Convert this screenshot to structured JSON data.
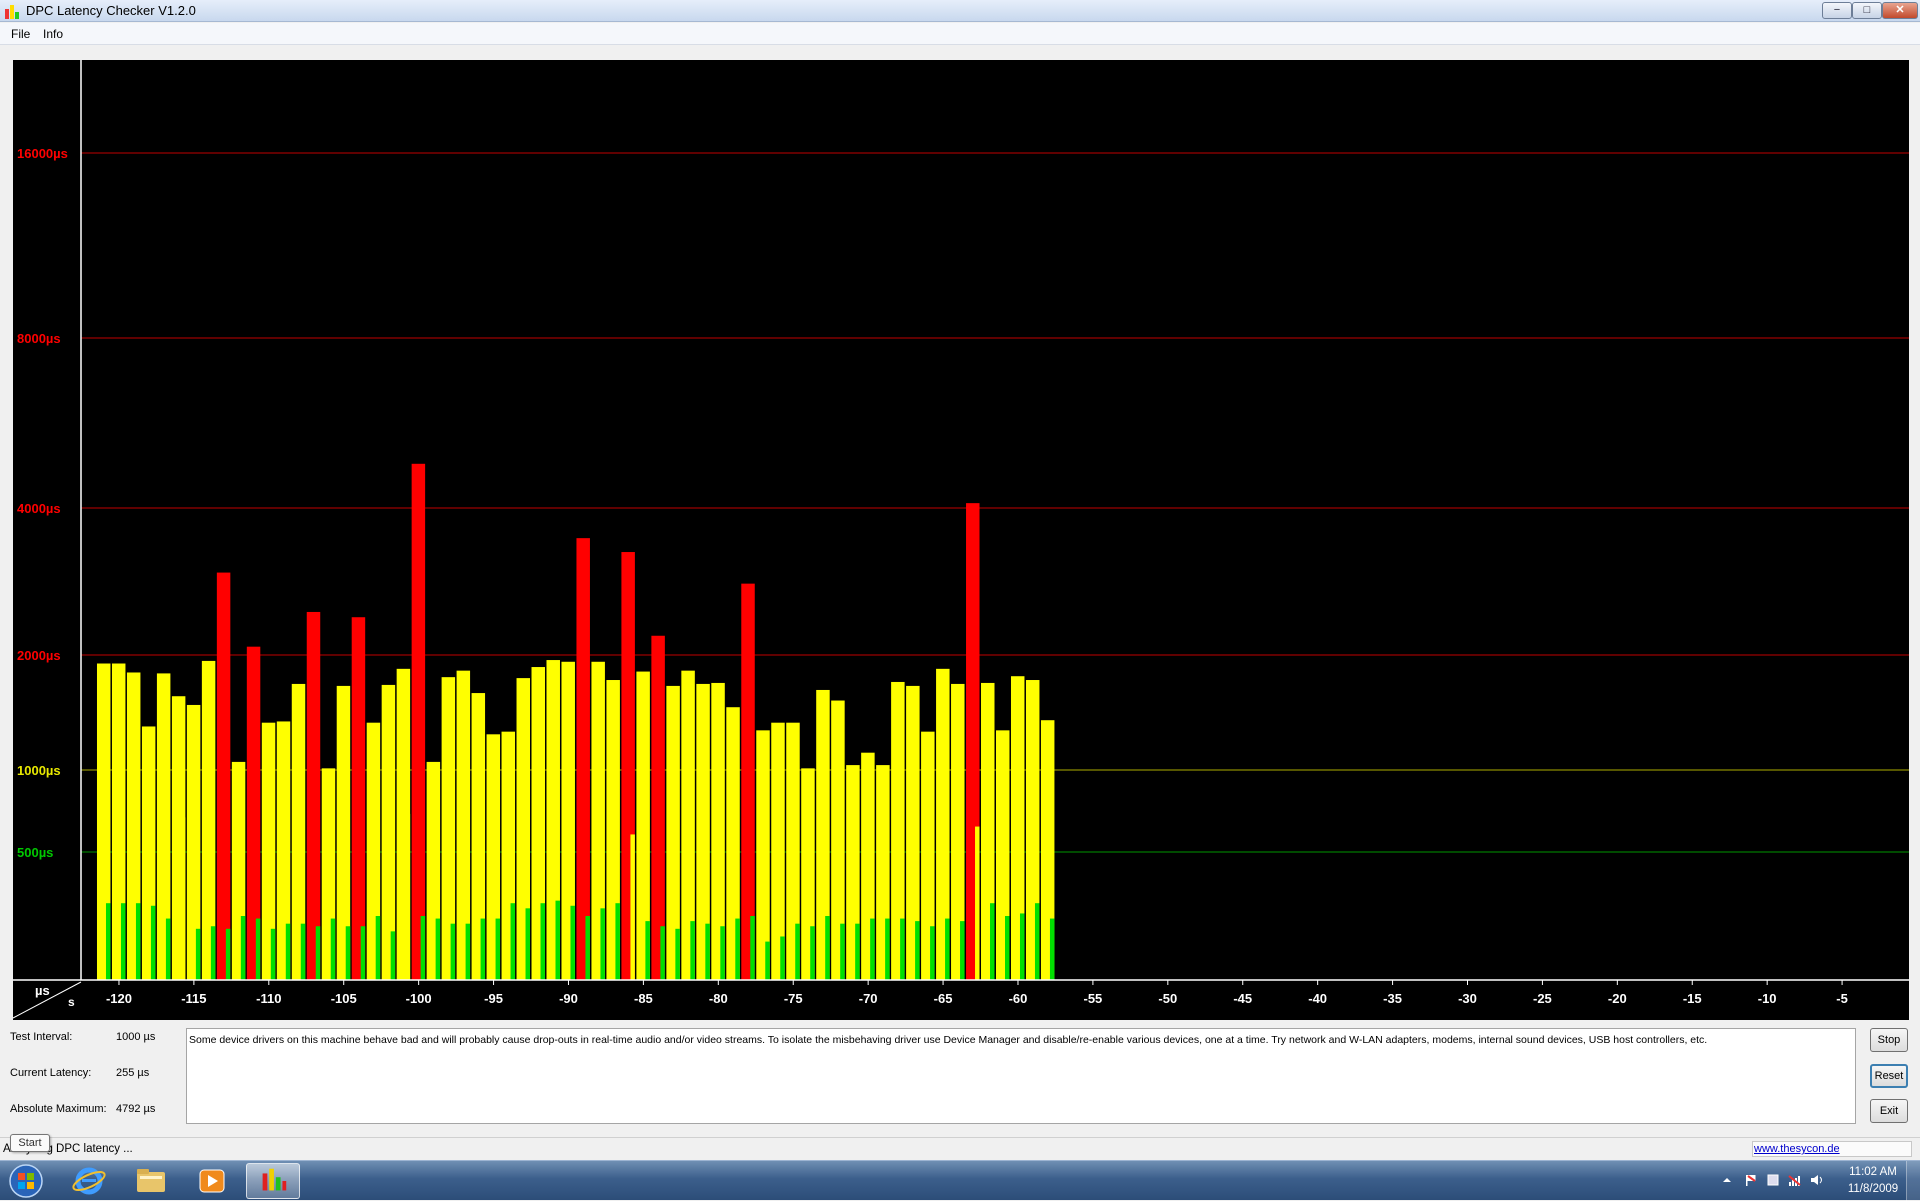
{
  "window": {
    "title": "DPC Latency Checker V1.2.0",
    "controls": {
      "minimize": "−",
      "maximize": "□",
      "close": "✕"
    }
  },
  "menu": {
    "file": "File",
    "info": "Info"
  },
  "chart_data": {
    "type": "bar",
    "y_scale": "non-linear",
    "y_ticks": [
      {
        "value": 500,
        "label": "500µs",
        "color": "#00c800"
      },
      {
        "value": 1000,
        "label": "1000µs",
        "color": "#e8e800"
      },
      {
        "value": 2000,
        "label": "2000µs",
        "color": "#ff0000"
      },
      {
        "value": 4000,
        "label": "4000µs",
        "color": "#ff0000"
      },
      {
        "value": 8000,
        "label": "8000µs",
        "color": "#ff0000"
      },
      {
        "value": 16000,
        "label": "16000µs",
        "color": "#ff0000"
      }
    ],
    "y_corner_label": "µs",
    "x_corner_label": "s",
    "x_ticks": [
      "-120",
      "-115",
      "-110",
      "-105",
      "-100",
      "-95",
      "-90",
      "-85",
      "-80",
      "-75",
      "-70",
      "-65",
      "-60",
      "-55",
      "-50",
      "-45",
      "-40",
      "-35",
      "-30",
      "-25",
      "-20",
      "-15",
      "-10",
      "-5"
    ],
    "x_range": [
      -122,
      0
    ],
    "colors": {
      "green": "#00e000",
      "yellow": "#ffff00",
      "red": "#ff0000",
      "background": "#000000",
      "axis": "#ffffff"
    },
    "samples": [
      {
        "t": -121,
        "max": 1900,
        "cur": 300
      },
      {
        "t": -120,
        "max": 1900,
        "cur": 300
      },
      {
        "t": -119,
        "max": 1800,
        "cur": 300
      },
      {
        "t": -118,
        "max": 1300,
        "cur": 290
      },
      {
        "t": -117,
        "max": 1790,
        "cur": 240
      },
      {
        "t": -116,
        "max": 1560,
        "cur": 670
      },
      {
        "t": -115,
        "max": 1480,
        "cur": 200
      },
      {
        "t": -114,
        "max": 1930,
        "cur": 210
      },
      {
        "t": -113,
        "max": 2950,
        "cur": 200
      },
      {
        "t": -112,
        "max": 1050,
        "cur": 250
      },
      {
        "t": -111,
        "max": 2080,
        "cur": 240
      },
      {
        "t": -110,
        "max": 1330,
        "cur": 200
      },
      {
        "t": -109,
        "max": 1340,
        "cur": 220
      },
      {
        "t": -108,
        "max": 1680,
        "cur": 220
      },
      {
        "t": -107,
        "max": 2450,
        "cur": 210
      },
      {
        "t": -106,
        "max": 1010,
        "cur": 240
      },
      {
        "t": -105,
        "max": 1660,
        "cur": 210
      },
      {
        "t": -104,
        "max": 2390,
        "cur": 210
      },
      {
        "t": -103,
        "max": 1330,
        "cur": 250
      },
      {
        "t": -102,
        "max": 1670,
        "cur": 190
      },
      {
        "t": -101,
        "max": 1840,
        "cur": 690
      },
      {
        "t": -100,
        "max": 4790,
        "cur": 250
      },
      {
        "t": -99,
        "max": 1050,
        "cur": 240
      },
      {
        "t": -98,
        "max": 1750,
        "cur": 220
      },
      {
        "t": -97,
        "max": 1820,
        "cur": 220
      },
      {
        "t": -96,
        "max": 1590,
        "cur": 240
      },
      {
        "t": -95,
        "max": 1240,
        "cur": 240
      },
      {
        "t": -94,
        "max": 1260,
        "cur": 300
      },
      {
        "t": -93,
        "max": 1740,
        "cur": 280
      },
      {
        "t": -92,
        "max": 1860,
        "cur": 300
      },
      {
        "t": -91,
        "max": 1940,
        "cur": 310
      },
      {
        "t": -90,
        "max": 1920,
        "cur": 290
      },
      {
        "t": -89,
        "max": 3470,
        "cur": 250
      },
      {
        "t": -88,
        "max": 1920,
        "cur": 280
      },
      {
        "t": -87,
        "max": 1720,
        "cur": 300
      },
      {
        "t": -86,
        "max": 3250,
        "cur": 580
      },
      {
        "t": -85,
        "max": 1810,
        "cur": 230
      },
      {
        "t": -84,
        "max": 2190,
        "cur": 210
      },
      {
        "t": -83,
        "max": 1660,
        "cur": 200
      },
      {
        "t": -82,
        "max": 1820,
        "cur": 230
      },
      {
        "t": -81,
        "max": 1680,
        "cur": 220
      },
      {
        "t": -80,
        "max": 1690,
        "cur": 210
      },
      {
        "t": -79,
        "max": 1460,
        "cur": 240
      },
      {
        "t": -78,
        "max": 2800,
        "cur": 250
      },
      {
        "t": -77,
        "max": 1270,
        "cur": 150
      },
      {
        "t": -76,
        "max": 1330,
        "cur": 170
      },
      {
        "t": -75,
        "max": 1330,
        "cur": 220
      },
      {
        "t": -74,
        "max": 1010,
        "cur": 210
      },
      {
        "t": -73,
        "max": 1620,
        "cur": 250
      },
      {
        "t": -72,
        "max": 1520,
        "cur": 220
      },
      {
        "t": -71,
        "max": 1030,
        "cur": 220
      },
      {
        "t": -70,
        "max": 1110,
        "cur": 240
      },
      {
        "t": -69,
        "max": 1030,
        "cur": 240
      },
      {
        "t": -68,
        "max": 1700,
        "cur": 240
      },
      {
        "t": -67,
        "max": 1660,
        "cur": 230
      },
      {
        "t": -66,
        "max": 1260,
        "cur": 210
      },
      {
        "t": -65,
        "max": 1840,
        "cur": 240
      },
      {
        "t": -64,
        "max": 1680,
        "cur": 230
      },
      {
        "t": -63,
        "max": 4080,
        "cur": 620
      },
      {
        "t": -62,
        "max": 1690,
        "cur": 300
      },
      {
        "t": -61,
        "max": 1270,
        "cur": 250
      },
      {
        "t": -60,
        "max": 1760,
        "cur": 260
      },
      {
        "t": -59,
        "max": 1720,
        "cur": 300
      },
      {
        "t": -58,
        "max": 1350,
        "cur": 240
      }
    ]
  },
  "info": {
    "test_interval_label": "Test Interval:",
    "test_interval_value": "1000 µs",
    "current_latency_label": "Current Latency:",
    "current_latency_value": "255 µs",
    "absolute_max_label": "Absolute Maximum:",
    "absolute_max_value": "4792 µs",
    "message": "Some device drivers on this machine behave bad and will probably cause drop-outs in real-time audio and/or video streams. To isolate the misbehaving driver use Device Manager and disable/re-enable various devices, one at a time. Try network and W-LAN adapters, modems, internal sound devices, USB host controllers, etc."
  },
  "buttons": {
    "stop": "Stop",
    "reset": "Reset",
    "exit": "Exit"
  },
  "status": {
    "text": "Analyzing DPC latency ...",
    "link": "www.thesycon.de",
    "tooltip": "Start"
  },
  "taskbar": {
    "time": "11:02 AM",
    "date": "11/8/2009"
  }
}
